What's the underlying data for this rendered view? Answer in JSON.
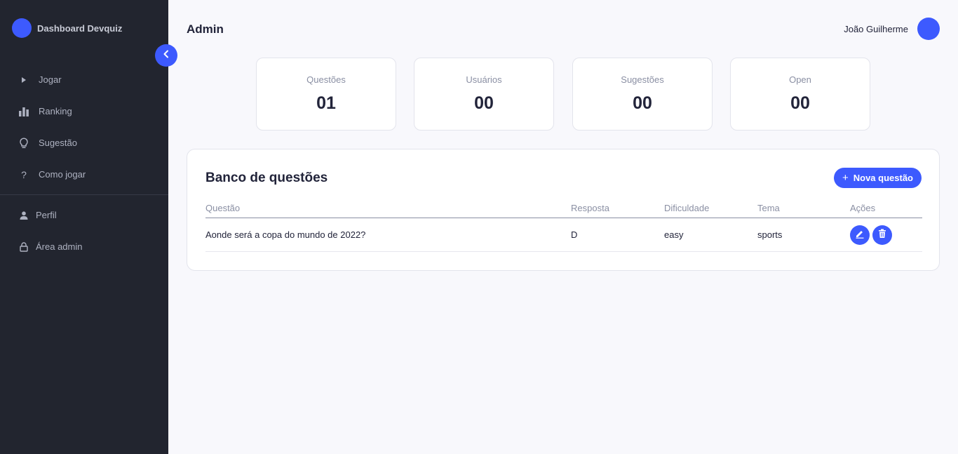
{
  "sidebar": {
    "brand": "Dashboard Devquiz",
    "items_top": [
      {
        "label": "Jogar",
        "icon": "play-icon"
      },
      {
        "label": "Ranking",
        "icon": "bar-chart-icon"
      },
      {
        "label": "Sugestão",
        "icon": "lightbulb-icon"
      },
      {
        "label": "Como jogar",
        "icon": "question-icon"
      }
    ],
    "items_bottom": [
      {
        "label": "Perfil",
        "icon": "user-icon"
      },
      {
        "label": "Área admin",
        "icon": "lock-icon"
      }
    ]
  },
  "header": {
    "title": "Admin",
    "user_name": "João Guilherme"
  },
  "stats": [
    {
      "label": "Questões",
      "value": "01"
    },
    {
      "label": "Usuários",
      "value": "00"
    },
    {
      "label": "Sugestões",
      "value": "00"
    },
    {
      "label": "Open",
      "value": "00"
    }
  ],
  "panel": {
    "title": "Banco de questões",
    "new_button": "Nova questão",
    "columns": [
      "Questão",
      "Resposta",
      "Dificuldade",
      "Tema",
      "Ações"
    ],
    "rows": [
      {
        "question": "Aonde será a copa do mundo de 2022?",
        "answer": "D",
        "difficulty": "easy",
        "theme": "sports"
      }
    ]
  },
  "colors": {
    "accent": "#3d5afe",
    "sidebar_bg": "#22252f",
    "page_bg": "#f8f8fc"
  }
}
